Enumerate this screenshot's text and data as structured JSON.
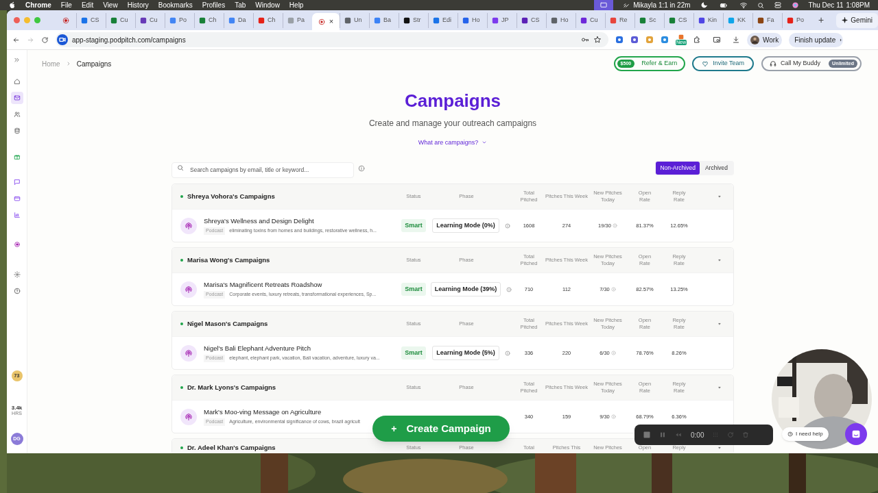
{
  "menu_bar": {
    "menus": [
      "Chrome",
      "File",
      "Edit",
      "View",
      "History",
      "Bookmarks",
      "Profiles",
      "Tab",
      "Window",
      "Help"
    ],
    "meeting": "Mikayla 1:1 in 22m",
    "date": "Thu Dec 11",
    "time": "1:08PM"
  },
  "tabs": [
    {
      "label": "CS",
      "selected": false
    },
    {
      "label": "Cu",
      "selected": false
    },
    {
      "label": "Cu",
      "selected": false
    },
    {
      "label": "Po",
      "selected": false
    },
    {
      "label": "Ch",
      "selected": false
    },
    {
      "label": "Da",
      "selected": false
    },
    {
      "label": "Ch",
      "selected": false
    },
    {
      "label": "Pa",
      "selected": false
    },
    {
      "selected": true,
      "close": "×"
    },
    {
      "label": "Un",
      "selected": false
    },
    {
      "label": "Ba",
      "selected": false
    },
    {
      "label": "Str",
      "selected": false
    },
    {
      "label": "Edi",
      "selected": false
    },
    {
      "label": "Ho",
      "selected": false
    },
    {
      "label": "JP",
      "selected": false
    },
    {
      "label": "CS",
      "selected": false
    },
    {
      "label": "Ho",
      "selected": false
    },
    {
      "label": "Cu",
      "selected": false
    },
    {
      "label": "Re",
      "selected": false
    },
    {
      "label": "Sc",
      "selected": false
    },
    {
      "label": "CS",
      "selected": false
    },
    {
      "label": "Kin",
      "selected": false
    },
    {
      "label": "KK",
      "selected": false
    },
    {
      "label": "Fa",
      "selected": false
    },
    {
      "label": "Po",
      "selected": false
    }
  ],
  "new_tab": "+",
  "gemini": "Gemini",
  "address_bar": {
    "url": "app-staging.podpitch.com/campaigns",
    "profile": "Work",
    "update_button": "Finish update",
    "extension_badge": "New"
  },
  "sidebar": {
    "items": [
      {
        "selected": false
      },
      {
        "selected": true
      },
      {
        "selected": false
      },
      {
        "selected": false
      },
      {
        "selected": false
      },
      {
        "selected": false
      },
      {
        "selected": false
      },
      {
        "selected": false
      },
      {
        "selected": false
      },
      {
        "selected": false
      },
      {
        "selected": false
      }
    ],
    "badge": "73",
    "hours": "3.4k",
    "hours_unit": "HRS",
    "avatar": "DG"
  },
  "breadcrumb": [
    "Home",
    "Campaigns"
  ],
  "header_buttons": {
    "refer": {
      "badge": "$500",
      "label": "Refer & Earn"
    },
    "invite": "Invite Team",
    "buddy": {
      "label": "Call My Buddy",
      "badge": "Unlimited"
    }
  },
  "title": "Campaigns",
  "subtitle": "Create and manage your outreach campaigns",
  "help_link": "What are campaigns?",
  "search": {
    "placeholder": "Search campaigns by email, title or keyword..."
  },
  "filter": [
    {
      "label": "Non-Archived",
      "selected": true
    },
    {
      "label": "Archived",
      "selected": false
    }
  ],
  "groups": [
    {
      "name": "Shreya Vohora's Campaigns",
      "columns": [
        "Status",
        "Phase",
        "Total Pitched",
        "Pitches This Week",
        "New Pitches Today",
        "Open Rate",
        "Reply Rate"
      ],
      "rows": [
        {
          "title": "Shreya's Wellness and Design Delight",
          "type": "Podcast",
          "keywords": "eliminating toxins from homes and buildings, restorative wellness, h...",
          "status": "Smart",
          "phase": "Learning Mode (0%)",
          "total": "1608",
          "week": "274",
          "today": "19/30",
          "open": "81.37%",
          "reply": "12.65%"
        }
      ]
    },
    {
      "name": "Marisa Wong's Campaigns",
      "columns": [
        "Status",
        "Phase",
        "Total Pitched",
        "Pitches This Week",
        "New Pitches Today",
        "Open Rate",
        "Reply Rate"
      ],
      "rows": [
        {
          "title": "Marisa's Magnificent Retreats Roadshow",
          "type": "Podcast",
          "keywords": "Corporate events, luxury retreats, transformational experiences, Sp...",
          "status": "Smart",
          "phase": "Learning Mode (39%)",
          "total": "710",
          "week": "112",
          "today": "7/30",
          "open": "82.57%",
          "reply": "13.25%"
        }
      ]
    },
    {
      "name": "Nigel Mason's Campaigns",
      "columns": [
        "Status",
        "Phase",
        "Total Pitched",
        "Pitches This Week",
        "New Pitches Today",
        "Open Rate",
        "Reply Rate"
      ],
      "rows": [
        {
          "title": "Nigel's Bali Elephant Adventure Pitch",
          "type": "Podcast",
          "keywords": "elephant, elephant park, vacation, Bali vacation, adventure, luxury va...",
          "status": "Smart",
          "phase": "Learning Mode (5%)",
          "total": "336",
          "week": "220",
          "today": "6/30",
          "open": "78.76%",
          "reply": "8.26%"
        }
      ]
    },
    {
      "name": "Dr. Mark Lyons's Campaigns",
      "columns": [
        "Status",
        "Phase",
        "Total Pitched",
        "Pitches This Week",
        "New Pitches Today",
        "Open Rate",
        "Reply Rate"
      ],
      "rows": [
        {
          "title": "Mark's Moo-ving Message on Agriculture",
          "type": "Podcast",
          "keywords": "Agriculture, environmental significance of cows, brazil agricult",
          "total": "340",
          "week": "159",
          "today": "9/30",
          "open": "68.79%",
          "reply": "6.36%"
        }
      ]
    },
    {
      "name": "Dr. Adeel Khan's Campaigns",
      "columns": [
        "Status",
        "Phase",
        "Total",
        "Pitches This",
        "New Pitches",
        "Open",
        "Reply"
      ]
    }
  ],
  "create_button": {
    "icon": "+",
    "label": "Create Campaign"
  },
  "recorder": {
    "time": "0:00"
  },
  "help_button": "I need help"
}
